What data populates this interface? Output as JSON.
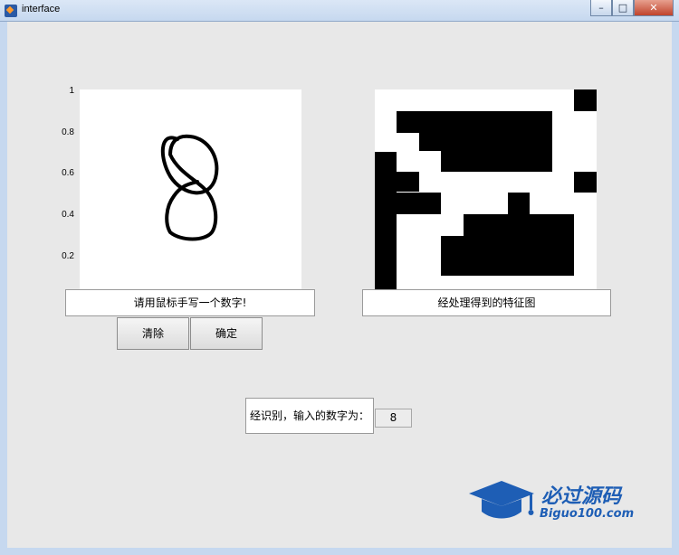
{
  "window": {
    "title": "interface"
  },
  "left_axes": {
    "yticks": [
      "1",
      "0.8",
      "0.6",
      "0.4",
      "0.2"
    ],
    "drawn_digit_label": "8"
  },
  "labels": {
    "left_caption": "请用鼠标手写一个数字!",
    "right_caption": "经处理得到的特征图"
  },
  "buttons": {
    "clear": "清除",
    "confirm": "确定"
  },
  "result": {
    "label": "经识别，输入的数字为：",
    "value": "8"
  },
  "logo": {
    "cn": "必过源码",
    "en": "Biguo100.com",
    "color": "#1e5eb5"
  }
}
